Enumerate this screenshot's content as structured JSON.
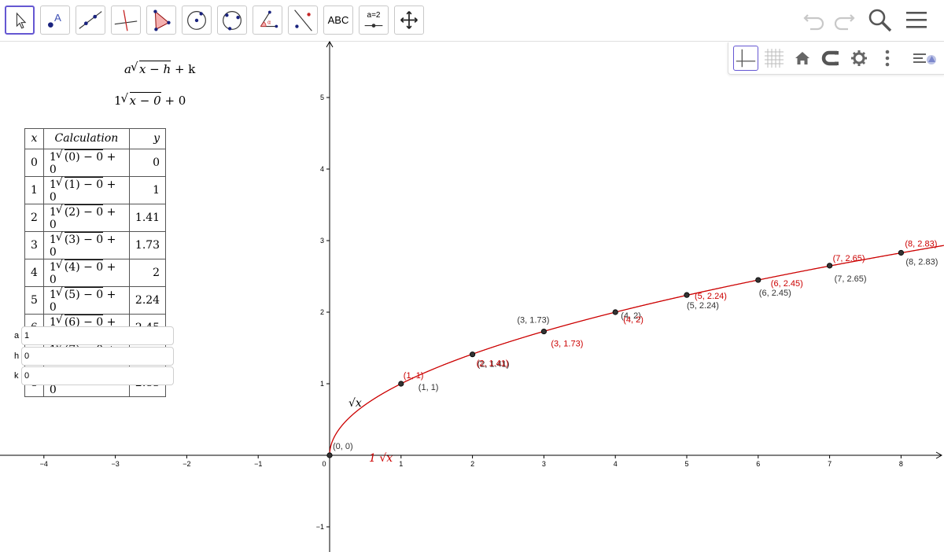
{
  "toolbar": {
    "tools": [
      {
        "name": "move",
        "label": "",
        "active": true
      },
      {
        "name": "point",
        "label": "",
        "active": false
      },
      {
        "name": "line",
        "label": "",
        "active": false
      },
      {
        "name": "perpendicular-line",
        "label": "",
        "active": false
      },
      {
        "name": "polygon",
        "label": "",
        "active": false
      },
      {
        "name": "circle-center-point",
        "label": "",
        "active": false
      },
      {
        "name": "circle-three-points",
        "label": "",
        "active": false
      },
      {
        "name": "angle",
        "label": "",
        "active": false
      },
      {
        "name": "reflect",
        "label": "",
        "active": false
      },
      {
        "name": "text",
        "label": "ABC",
        "active": false
      },
      {
        "name": "slider",
        "label": "a=2",
        "active": false
      },
      {
        "name": "move-graphics",
        "label": "",
        "active": false
      }
    ],
    "right_icons": [
      "undo-icon",
      "redo-icon",
      "search-icon",
      "menu-icon"
    ]
  },
  "style_bar": {
    "icons": [
      "axes-toggle-icon",
      "grid-toggle-icon",
      "home-icon",
      "magnet-icon",
      "gear-icon",
      "more-vert-icon",
      "style-bar-toggle-icon"
    ]
  },
  "formulas": {
    "general": {
      "a": "a",
      "radicand": "x − h",
      "tail": "+ k"
    },
    "specific": {
      "a": "1",
      "radicand": "x − 0",
      "tail": "+ 0"
    }
  },
  "table": {
    "headers": [
      "x",
      "Calculation",
      "y"
    ],
    "rows": [
      {
        "x": "0",
        "a": "1",
        "radicand": "(0) − 0",
        "tail": "+ 0",
        "y": "0"
      },
      {
        "x": "1",
        "a": "1",
        "radicand": "(1) − 0",
        "tail": "+ 0",
        "y": "1"
      },
      {
        "x": "2",
        "a": "1",
        "radicand": "(2) − 0",
        "tail": "+ 0",
        "y": "1.41"
      },
      {
        "x": "3",
        "a": "1",
        "radicand": "(3) − 0",
        "tail": "+ 0",
        "y": "1.73"
      },
      {
        "x": "4",
        "a": "1",
        "radicand": "(4) − 0",
        "tail": "+ 0",
        "y": "2"
      },
      {
        "x": "5",
        "a": "1",
        "radicand": "(5) − 0",
        "tail": "+ 0",
        "y": "2.24"
      },
      {
        "x": "6",
        "a": "1",
        "radicand": "(6) − 0",
        "tail": "+ 0",
        "y": "2.45"
      },
      {
        "x": "7",
        "a": "1",
        "radicand": "(7) − 0",
        "tail": "+ 0",
        "y": "2.65"
      },
      {
        "x": "8",
        "a": "1",
        "radicand": "(8) − 0",
        "tail": "+ 0",
        "y": "2.83"
      }
    ]
  },
  "sliders": [
    {
      "name": "a",
      "value": "1"
    },
    {
      "name": "h",
      "value": "0"
    },
    {
      "name": "k",
      "value": "0"
    }
  ],
  "graph": {
    "x_ticks": [
      -4,
      -3,
      -2,
      -1,
      0,
      1,
      2,
      3,
      4,
      5,
      6,
      7,
      8
    ],
    "y_ticks": [
      -1,
      1,
      2,
      3,
      4,
      5
    ],
    "x_tick_labels": [
      "−4",
      "−3",
      "−2",
      "−1",
      "0",
      "1",
      "2",
      "3",
      "4",
      "5",
      "6",
      "7",
      "8"
    ],
    "y_tick_labels": [
      "−1",
      "1",
      "2",
      "3",
      "4",
      "5"
    ],
    "curve_color": "#cc0000",
    "points": [
      {
        "x": 0,
        "y": 0,
        "label": "(0, 0)"
      },
      {
        "x": 1,
        "y": 1,
        "label": "(1, 1)"
      },
      {
        "x": 2,
        "y": 1.41,
        "label": "(2, 1.41)"
      },
      {
        "x": 3,
        "y": 1.73,
        "label": "(3, 1.73)"
      },
      {
        "x": 4,
        "y": 2,
        "label": "(4, 2)"
      },
      {
        "x": 5,
        "y": 2.24,
        "label": "(5, 2.24)"
      },
      {
        "x": 6,
        "y": 2.45,
        "label": "(6, 2.45)"
      },
      {
        "x": 7,
        "y": 2.65,
        "label": "(7, 2.65)"
      },
      {
        "x": 8,
        "y": 2.83,
        "label": "(8, 2.83)"
      }
    ],
    "red_labels": [
      "(1, 1)",
      "(2, 1.41)",
      "(3, 1.73)",
      "(4, 2)",
      "(5, 2.24)",
      "(6, 2.45)",
      "(7, 2.65)",
      "(8, 2.83)"
    ],
    "curve_labels": {
      "black": "√x",
      "red": "1 √x"
    }
  }
}
